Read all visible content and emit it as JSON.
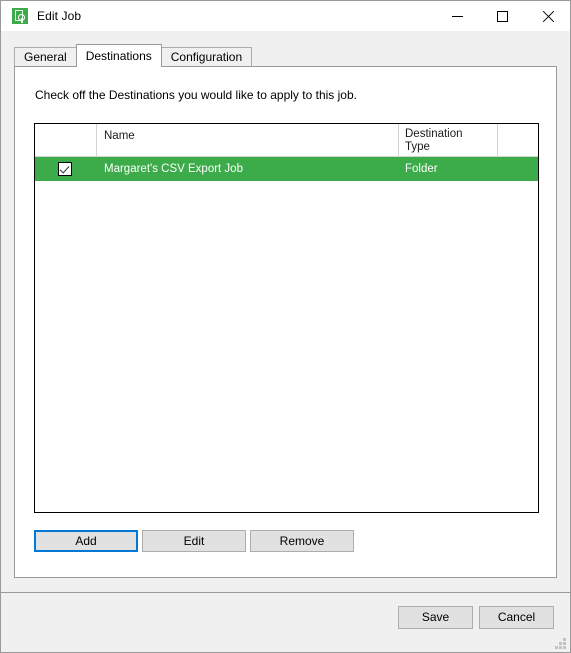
{
  "window": {
    "title": "Edit Job",
    "icon": "job-lock-icon",
    "controls": {
      "minimize": "minimize-icon",
      "maximize": "maximize-icon",
      "close": "close-icon"
    }
  },
  "tabs": [
    {
      "label": "General",
      "selected": false
    },
    {
      "label": "Destinations",
      "selected": true
    },
    {
      "label": "Configuration",
      "selected": false
    }
  ],
  "page": {
    "hint": "Check off the Destinations you would like to apply to this job."
  },
  "grid": {
    "columns": [
      {
        "key": "check",
        "label": ""
      },
      {
        "key": "name",
        "label": "Name"
      },
      {
        "key": "type",
        "label": "Destination\nType"
      },
      {
        "key": "last",
        "label": ""
      }
    ],
    "column_header_type_line1": "Destination",
    "column_header_type_line2": "Type",
    "rows": [
      {
        "checked": true,
        "name": "Margaret's CSV Export Job",
        "type": "Folder",
        "selected": true
      }
    ]
  },
  "actions": {
    "add_label": "Add",
    "edit_label": "Edit",
    "remove_label": "Remove"
  },
  "footer": {
    "save_label": "Save",
    "cancel_label": "Cancel"
  },
  "colors": {
    "selection_green": "#3cab4a",
    "focus_blue": "#0078d7",
    "window_chrome": "#f0f0f0"
  }
}
